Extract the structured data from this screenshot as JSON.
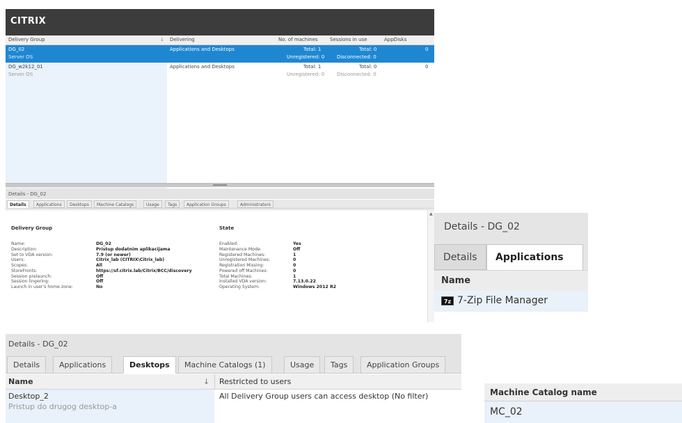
{
  "app": {
    "brand": "CITRIX"
  },
  "grid": {
    "columns": {
      "delivery_group": "Delivery Group",
      "delivering": "Delivering",
      "machines": "No. of machines",
      "sessions": "Sessions in use",
      "appdisks": "AppDisks"
    },
    "rows": [
      {
        "name": "DG_02",
        "type": "Server OS",
        "delivering": "Applications and Desktops",
        "machines_total": "Total: 1",
        "machines_unreg": "Unregistered: 0",
        "sessions_total": "Total: 0",
        "sessions_disc": "Disconnected: 0",
        "appdisks": "0"
      },
      {
        "name": "DG_w2k12_01",
        "type": "Server OS",
        "delivering": "Applications and Desktops",
        "machines_total": "Total: 1",
        "machines_unreg": "Unregistered: 0",
        "sessions_total": "Total: 0",
        "sessions_disc": "Disconnected: 0",
        "appdisks": "0"
      }
    ]
  },
  "details": {
    "title": "Details - DG_02",
    "tabs": [
      "Details",
      "Applications",
      "Desktops",
      "Machine Catalogs",
      "Usage",
      "Tags",
      "Application Groups",
      "Administrators"
    ],
    "left_heading": "Delivery Group",
    "right_heading": "State",
    "left": [
      {
        "k": "Name:",
        "v": "DG_02"
      },
      {
        "k": "Description:",
        "v": "Pristup dodatnim aplikacijama"
      },
      {
        "k": "Set to VDA version:",
        "v": "7.9 (or newer)"
      },
      {
        "k": "Users:",
        "v": "Citrix_lab (CITRIX\\Citrix_lab)"
      },
      {
        "k": "Scopes:",
        "v": "All"
      },
      {
        "k": "StoreFronts:",
        "v": "https://sf.citrix.lab/Citrix/BCC/discovery"
      },
      {
        "k": "Session prelaunch:",
        "v": "Off"
      },
      {
        "k": "Session lingering:",
        "v": "Off"
      },
      {
        "k": "Launch in user's home zone:",
        "v": "No"
      }
    ],
    "right": [
      {
        "k": "Enabled:",
        "v": "Yes"
      },
      {
        "k": "Maintenance Mode:",
        "v": "Off"
      },
      {
        "k": "Registered Machines:",
        "v": "1"
      },
      {
        "k": "Unregistered Machines:",
        "v": "0"
      },
      {
        "k": "Registration Missing:",
        "v": "0"
      },
      {
        "k": "Powered off Machines:",
        "v": "0"
      },
      {
        "k": "Total Machines:",
        "v": "1"
      },
      {
        "k": "Installed VDA version:",
        "v": "7.13.0.22"
      },
      {
        "k": "Operating System:",
        "v": "Windows 2012 R2"
      }
    ]
  },
  "zoom_apps": {
    "title": "Details - DG_02",
    "tab_details": "Details",
    "tab_applications": "Applications",
    "col_name": "Name",
    "app_icon_text": "7z",
    "app_name": "7-Zip File Manager"
  },
  "zoom_desktops": {
    "title": "Details - DG_02",
    "tabs": [
      "Details",
      "Applications",
      "Desktops",
      "Machine Catalogs (1)",
      "Usage",
      "Tags",
      "Application Groups"
    ],
    "col_name": "Name",
    "col_restricted": "Restricted to users",
    "desktop_name": "Desktop_2",
    "desktop_desc": "Pristup do drugog desktop-a",
    "restriction": "All Delivery Group users can access desktop (No filter)"
  },
  "zoom_catalogs": {
    "col_name": "Machine Catalog name",
    "catalog": "MC_02"
  }
}
